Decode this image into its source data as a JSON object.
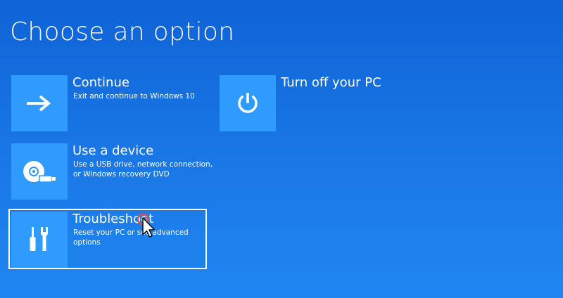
{
  "page": {
    "title": "Choose an option"
  },
  "options": {
    "continue": {
      "title": "Continue",
      "description": "Exit and continue to Windows 10",
      "icon": "arrow-right-icon"
    },
    "use_device": {
      "title": "Use a device",
      "description": "Use a USB drive, network connection,\nor Windows recovery DVD",
      "icon": "disc-usb-icon"
    },
    "troubleshoot": {
      "title": "Troubleshoot",
      "description": "Reset your PC or see advanced options",
      "icon": "tools-icon",
      "focused": true
    },
    "turn_off": {
      "title": "Turn off your PC",
      "icon": "power-icon"
    }
  },
  "colors": {
    "background_top": "#0f63d6",
    "background_bottom": "#1f86f0",
    "tile": "#2f9bff",
    "text": "#ffffff"
  }
}
